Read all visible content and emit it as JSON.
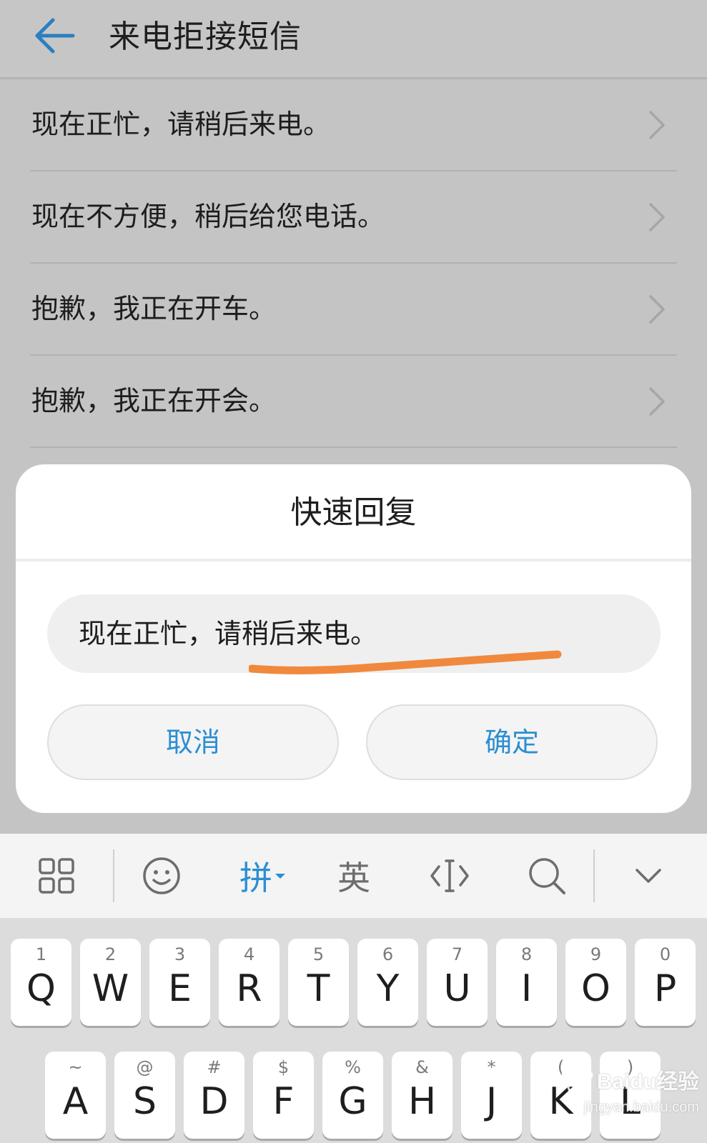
{
  "header": {
    "title": "来电拒接短信"
  },
  "messages": [
    {
      "text": "现在正忙，请稍后来电。"
    },
    {
      "text": "现在不方便，稍后给您电话。"
    },
    {
      "text": "抱歉，我正在开车。"
    },
    {
      "text": "抱歉，我正在开会。"
    }
  ],
  "dialog": {
    "title": "快速回复",
    "input_value": "现在正忙，请稍后来电。",
    "cancel_label": "取消",
    "confirm_label": "确定",
    "accent_color": "#2b8fd1",
    "highlight_color": "#f0893d"
  },
  "keyboard": {
    "toolbar": {
      "pinyin_label": "拼",
      "english_label": "英",
      "icons": [
        "grid-icon",
        "emoji-icon",
        "cursor-icon",
        "search-icon",
        "chevron-down-icon"
      ]
    },
    "row1": [
      {
        "main": "Q",
        "sub": "1"
      },
      {
        "main": "W",
        "sub": "2"
      },
      {
        "main": "E",
        "sub": "3"
      },
      {
        "main": "R",
        "sub": "4"
      },
      {
        "main": "T",
        "sub": "5"
      },
      {
        "main": "Y",
        "sub": "6"
      },
      {
        "main": "U",
        "sub": "7"
      },
      {
        "main": "I",
        "sub": "8"
      },
      {
        "main": "O",
        "sub": "9"
      },
      {
        "main": "P",
        "sub": "0"
      }
    ],
    "row2": [
      {
        "main": "A",
        "sub": "~"
      },
      {
        "main": "S",
        "sub": "@"
      },
      {
        "main": "D",
        "sub": "#"
      },
      {
        "main": "F",
        "sub": "$"
      },
      {
        "main": "G",
        "sub": "%"
      },
      {
        "main": "H",
        "sub": "&"
      },
      {
        "main": "J",
        "sub": "*"
      },
      {
        "main": "K",
        "sub": "("
      },
      {
        "main": "L",
        "sub": ")"
      }
    ]
  },
  "watermark": {
    "brand": "Baidu经验",
    "url": "jingyan.baidu.com"
  }
}
